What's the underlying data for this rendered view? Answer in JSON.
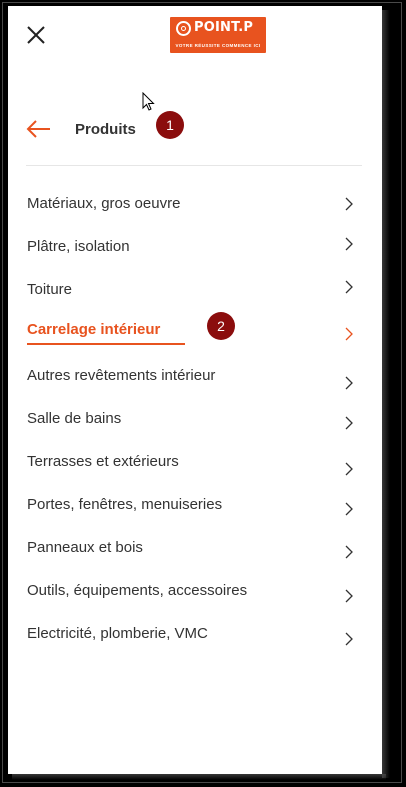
{
  "header": {
    "close_icon": "close-icon",
    "logo": {
      "name": "POINT.P",
      "tagline": "VOTRE RÉUSSITE COMMENCE ICI",
      "color": "#e8531f"
    }
  },
  "nav": {
    "back_icon": "arrow-left-icon",
    "title": "Produits",
    "accent_color": "#e8531f"
  },
  "annotations": {
    "badge_1": "1",
    "badge_2": "2",
    "badge_color": "#8b0d0d"
  },
  "menu": {
    "items": [
      {
        "label": "Matériaux, gros oeuvre",
        "icon": "chevron-right-icon"
      },
      {
        "label": "Plâtre, isolation",
        "icon": "chevron-right-icon"
      },
      {
        "label": "Toiture",
        "icon": "chevron-right-icon"
      },
      {
        "label": "Carrelage intérieur",
        "icon": "chevron-right-icon",
        "active": true
      },
      {
        "label": "Autres revêtements intérieur",
        "icon": "chevron-right-icon"
      },
      {
        "label": "Salle de bains",
        "icon": "chevron-right-icon"
      },
      {
        "label": "Terrasses et extérieurs",
        "icon": "chevron-right-icon"
      },
      {
        "label": "Portes, fenêtres, menuiseries",
        "icon": "chevron-right-icon"
      },
      {
        "label": "Panneaux et bois",
        "icon": "chevron-right-icon"
      },
      {
        "label": "Outils, équipements, accessoires",
        "icon": "chevron-right-icon"
      },
      {
        "label": "Electricité, plomberie, VMC",
        "icon": "chevron-right-icon"
      }
    ]
  }
}
